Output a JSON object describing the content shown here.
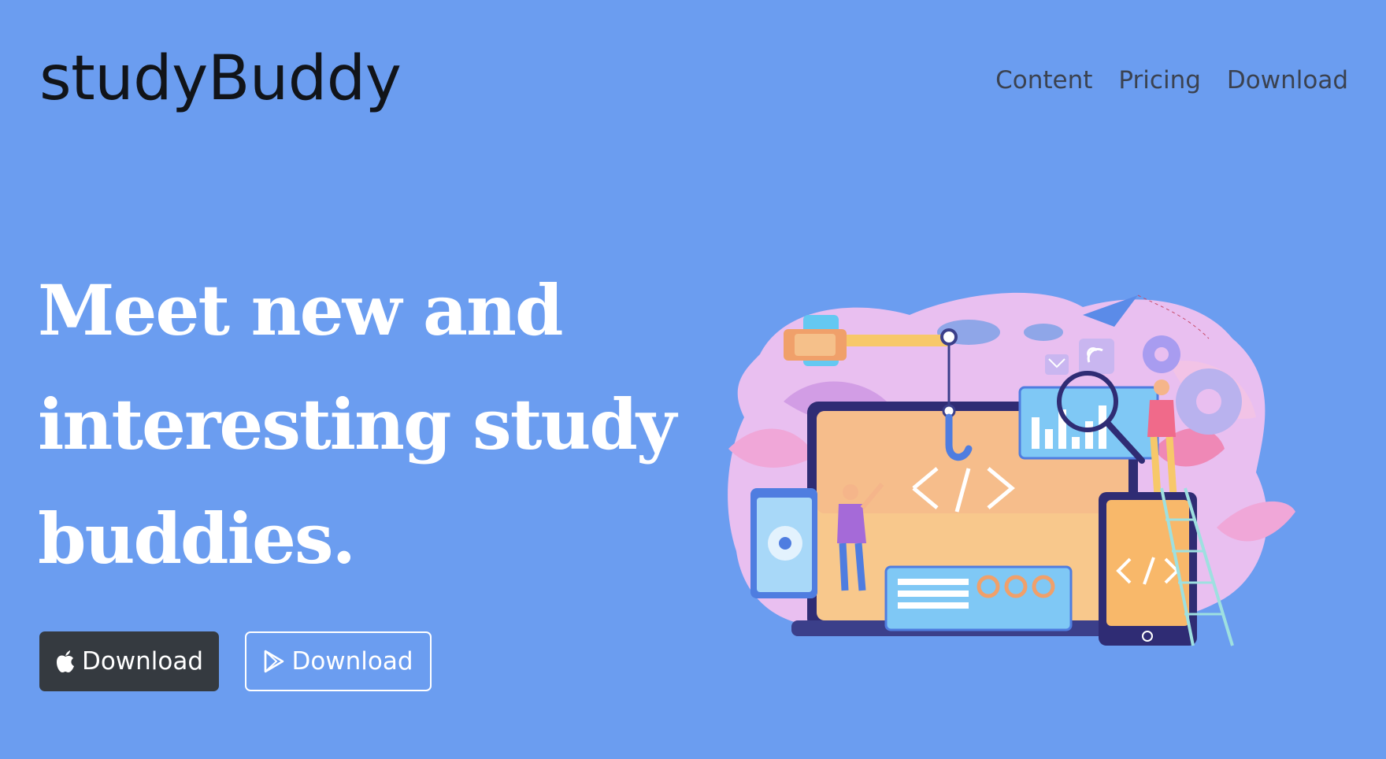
{
  "brand": "studyBuddy",
  "nav": {
    "items": [
      "Content",
      "Pricing",
      "Download"
    ]
  },
  "hero": {
    "headline": "Meet new and interesting study buddies."
  },
  "buttons": {
    "apple_label": "Download",
    "google_label": "Download"
  },
  "icons": {
    "apple": "apple-logo-icon",
    "google": "google-play-icon"
  },
  "colors": {
    "background": "#6b9df0",
    "brand_text": "#111419",
    "nav_text": "#3b4250",
    "headline": "#ffffff",
    "dark_button": "#353a40"
  }
}
